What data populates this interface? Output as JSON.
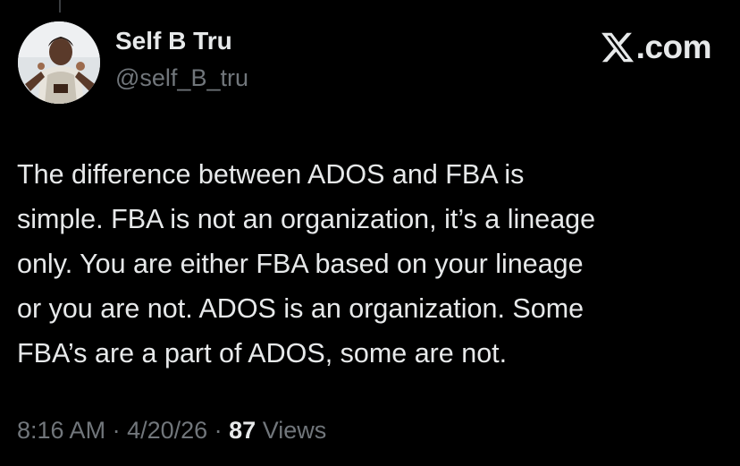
{
  "author": {
    "display_name": "Self B Tru",
    "handle": "@self_B_tru",
    "avatar_icon": "profile-photo"
  },
  "watermark": {
    "logo_icon": "x-logo-icon",
    "suffix": ".com"
  },
  "tweet": {
    "lines": [
      "The difference between ADOS and FBA is",
      "simple. FBA is not an organization, it’s a lineage",
      "only. You are either FBA based on your lineage",
      "or you are not. ADOS is an organization. Some",
      "FBA’s are a part of ADOS, some are not."
    ]
  },
  "meta": {
    "time": "8:16 AM",
    "separator": " · ",
    "date": "4/20/26",
    "views_count": "87",
    "views_label": " Views"
  },
  "colors": {
    "background": "#000000",
    "primary_text": "#e7e9ea",
    "secondary_text": "#71767b"
  }
}
